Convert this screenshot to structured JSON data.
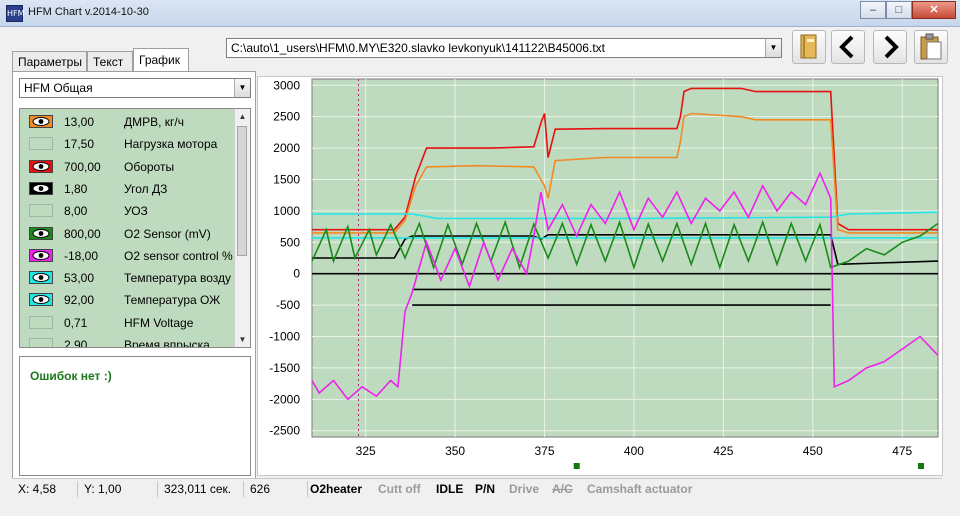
{
  "window": {
    "title": "HFM Chart  v.2014-10-30",
    "icon_text": "HFM",
    "buttons": [
      "minimize",
      "maximize",
      "close"
    ],
    "minimize_glyph": "–",
    "maximize_glyph": "□",
    "close_glyph": "✕"
  },
  "tabs": [
    {
      "label": "Параметры",
      "active": false
    },
    {
      "label": "Текст",
      "active": false
    },
    {
      "label": "График",
      "active": true
    }
  ],
  "file_path": "C:\\auto\\1_users\\HFM\\0.MY\\E320.slavko levkonyuk\\141122\\B45006.txt",
  "toolbar_icons": [
    "book-icon",
    "prev-arrow-icon",
    "next-arrow-icon",
    "clipboard-icon"
  ],
  "channel_group": "HFM Общая",
  "channels": [
    {
      "value": "13,00",
      "name": "ДМРВ, кг/ч",
      "color": "#f08a24",
      "visible": true
    },
    {
      "value": "17,50",
      "name": "Нагрузка мотора",
      "color": "#bfdbbf",
      "visible": false
    },
    {
      "value": "700,00",
      "name": "Обороты",
      "color": "#e81010",
      "visible": true
    },
    {
      "value": "1,80",
      "name": "Угол ДЗ",
      "color": "#000000",
      "visible": true
    },
    {
      "value": "8,00",
      "name": "УОЗ",
      "color": "#bfdbbf",
      "visible": false
    },
    {
      "value": "800,00",
      "name": "O2 Sensor (mV)",
      "color": "#1a8a1a",
      "visible": true
    },
    {
      "value": "-18,00",
      "name": "O2 sensor control %",
      "color": "#ee22ee",
      "visible": true
    },
    {
      "value": "53,00",
      "name": "Температура возду",
      "color": "#22e5e5",
      "visible": true
    },
    {
      "value": "92,00",
      "name": "Температура ОЖ",
      "color": "#22e5e5",
      "visible": true
    },
    {
      "value": "0,71",
      "name": "HFM Voltage",
      "color": "#bfdbbf",
      "visible": false
    },
    {
      "value": "2,90",
      "name": "Время впрыска",
      "color": "#bfdbbf",
      "visible": false
    }
  ],
  "errors_text": "Ошибок нет :)",
  "chart_data": {
    "type": "line",
    "xlim": [
      310,
      485
    ],
    "ylim": [
      -2600,
      3100
    ],
    "xticks": [
      325,
      350,
      375,
      400,
      425,
      450,
      475
    ],
    "yticks": [
      3000,
      2500,
      2000,
      1500,
      1000,
      500,
      0,
      -500,
      -1000,
      -1500,
      -2000,
      -2500
    ],
    "grid": true,
    "background": "#bfdbbf",
    "cursor_x": 323,
    "series": [
      {
        "color": "#e81010",
        "x": [
          310,
          333,
          336,
          339,
          342,
          360,
          372,
          374,
          375,
          376,
          378,
          392,
          412,
          413,
          414,
          416,
          430,
          434,
          455,
          457,
          460,
          470,
          485
        ],
        "y": [
          700,
          700,
          900,
          1550,
          2000,
          2000,
          2020,
          2400,
          2550,
          1850,
          2300,
          2310,
          2310,
          2500,
          2900,
          2950,
          2950,
          2900,
          2900,
          800,
          700,
          700,
          700
        ]
      },
      {
        "color": "#f08a24",
        "x": [
          310,
          333,
          336,
          339,
          342,
          356,
          372,
          374,
          375,
          376,
          378,
          392,
          412,
          413,
          414,
          416,
          430,
          434,
          455,
          457,
          460,
          470,
          485
        ],
        "y": [
          650,
          650,
          850,
          1400,
          1700,
          1720,
          1700,
          1500,
          1400,
          1200,
          1800,
          1850,
          1850,
          2100,
          2500,
          2550,
          2500,
          2450,
          2450,
          700,
          650,
          650,
          650
        ]
      },
      {
        "color": "#000000",
        "x": [
          310,
          333,
          336,
          338,
          372,
          374,
          376,
          455,
          457,
          485
        ],
        "y": [
          250,
          250,
          550,
          600,
          600,
          550,
          620,
          620,
          150,
          200
        ]
      },
      {
        "color": "#000000",
        "x": [
          310,
          485
        ],
        "y": [
          0,
          0
        ]
      },
      {
        "color": "#000000",
        "x": [
          338,
          455
        ],
        "y": [
          -250,
          -250
        ]
      },
      {
        "color": "#000000",
        "x": [
          338,
          455
        ],
        "y": [
          -500,
          -500
        ]
      },
      {
        "color": "#22e5e5",
        "x": [
          310,
          338,
          345,
          400,
          455,
          460,
          485
        ],
        "y": [
          950,
          950,
          880,
          880,
          900,
          950,
          980
        ]
      },
      {
        "color": "#22e5e5",
        "x": [
          310,
          485
        ],
        "y": [
          570,
          570
        ]
      },
      {
        "color": "#1a8a1a",
        "x": [
          310,
          314,
          316,
          320,
          322,
          326,
          328,
          332,
          336,
          340,
          344,
          348,
          352,
          356,
          360,
          364,
          368,
          372,
          376,
          380,
          384,
          388,
          392,
          396,
          400,
          404,
          408,
          412,
          416,
          420,
          424,
          428,
          432,
          436,
          440,
          444,
          448,
          452,
          455,
          460,
          465,
          470,
          475,
          480,
          485
        ],
        "y": [
          200,
          700,
          200,
          750,
          250,
          700,
          300,
          780,
          250,
          800,
          100,
          780,
          150,
          800,
          200,
          820,
          100,
          790,
          250,
          800,
          150,
          780,
          200,
          820,
          100,
          790,
          200,
          800,
          150,
          800,
          100,
          780,
          200,
          820,
          150,
          800,
          200,
          780,
          100,
          200,
          400,
          300,
          500,
          600,
          800
        ]
      },
      {
        "color": "#ee22ee",
        "x": [
          310,
          312,
          316,
          320,
          324,
          328,
          332,
          334,
          336,
          338,
          340,
          342,
          346,
          350,
          354,
          358,
          362,
          366,
          370,
          372,
          374,
          376,
          380,
          384,
          388,
          392,
          396,
          400,
          404,
          408,
          412,
          416,
          420,
          424,
          428,
          432,
          436,
          440,
          444,
          448,
          452,
          455,
          456,
          460,
          465,
          470,
          475,
          480,
          485
        ],
        "y": [
          -1700,
          -1900,
          -1700,
          -2000,
          -1800,
          -1950,
          -1700,
          -1800,
          -600,
          -300,
          100,
          500,
          -100,
          400,
          -200,
          500,
          -100,
          400,
          0,
          600,
          1300,
          700,
          1100,
          600,
          1100,
          800,
          1300,
          700,
          1200,
          900,
          1300,
          800,
          1200,
          1000,
          1300,
          900,
          1400,
          1000,
          1300,
          1100,
          1600,
          1200,
          -1800,
          -1700,
          -1500,
          -1400,
          -1200,
          -1000,
          -1300
        ]
      }
    ]
  },
  "status": {
    "x_readout": "X: 4,58",
    "y_readout": "Y: 1,00",
    "time_readout": "323,011 сек.",
    "index_readout": "626",
    "flags": [
      {
        "label": "O2heater",
        "active": true,
        "strike": false
      },
      {
        "label": "Cutt off",
        "active": false,
        "strike": false
      },
      {
        "label": "IDLE",
        "active": true,
        "strike": false
      },
      {
        "label": "P/N",
        "active": true,
        "strike": false
      },
      {
        "label": "Drive",
        "active": false,
        "strike": false
      },
      {
        "label": "A/C",
        "active": false,
        "strike": true
      },
      {
        "label": "Camshaft actuator",
        "active": false,
        "strike": false
      }
    ]
  }
}
